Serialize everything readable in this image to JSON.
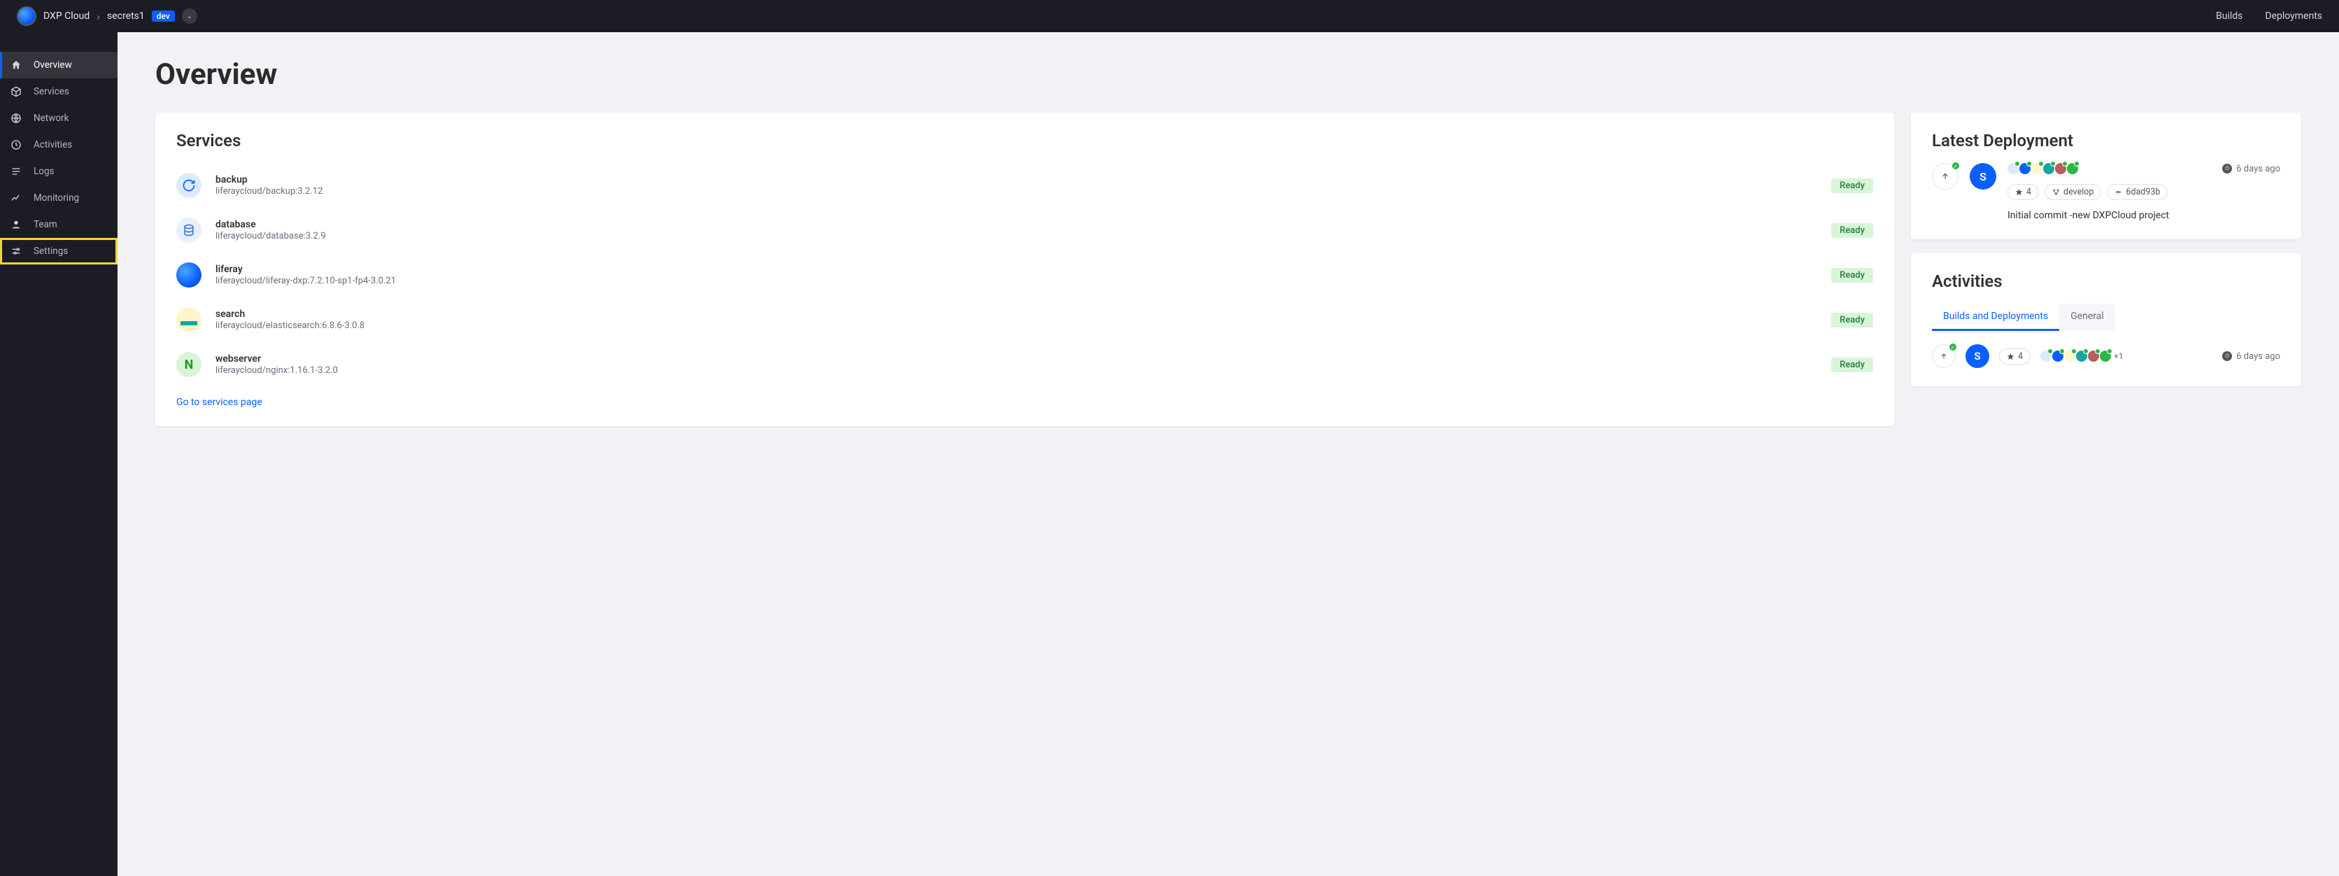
{
  "header": {
    "product": "DXP Cloud",
    "project": "secrets1",
    "env": "dev",
    "links": {
      "builds": "Builds",
      "deployments": "Deployments"
    }
  },
  "sidebar": {
    "items": [
      {
        "label": "Overview",
        "icon": "home"
      },
      {
        "label": "Services",
        "icon": "cube"
      },
      {
        "label": "Network",
        "icon": "globe"
      },
      {
        "label": "Activities",
        "icon": "clock"
      },
      {
        "label": "Logs",
        "icon": "list"
      },
      {
        "label": "Monitoring",
        "icon": "chart"
      },
      {
        "label": "Team",
        "icon": "person"
      },
      {
        "label": "Settings",
        "icon": "sliders"
      }
    ]
  },
  "page": {
    "title": "Overview"
  },
  "services_card": {
    "title": "Services",
    "link": "Go to services page",
    "items": [
      {
        "name": "backup",
        "version": "liferaycloud/backup:3.2.12",
        "status": "Ready"
      },
      {
        "name": "database",
        "version": "liferaycloud/database:3.2.9",
        "status": "Ready"
      },
      {
        "name": "liferay",
        "version": "liferaycloud/liferay-dxp:7.2.10-sp1-fp4-3.0.21",
        "status": "Ready"
      },
      {
        "name": "search",
        "version": "liferaycloud/elasticsearch:6.8.6-3.0.8",
        "status": "Ready"
      },
      {
        "name": "webserver",
        "version": "liferaycloud/nginx:1.16.1-3.2.0",
        "status": "Ready"
      }
    ]
  },
  "latest_deployment": {
    "title": "Latest Deployment",
    "avatar_initial": "S",
    "time_ago": "6 days ago",
    "build_count": "4",
    "branch": "develop",
    "commit": "6dad93b",
    "message": "Initial commit -new DXPCloud project"
  },
  "activities": {
    "title": "Activities",
    "tabs": {
      "builds": "Builds and Deployments",
      "general": "General"
    },
    "row": {
      "avatar_initial": "S",
      "build_count": "4",
      "extra": "+1",
      "time_ago": "6 days ago"
    }
  }
}
